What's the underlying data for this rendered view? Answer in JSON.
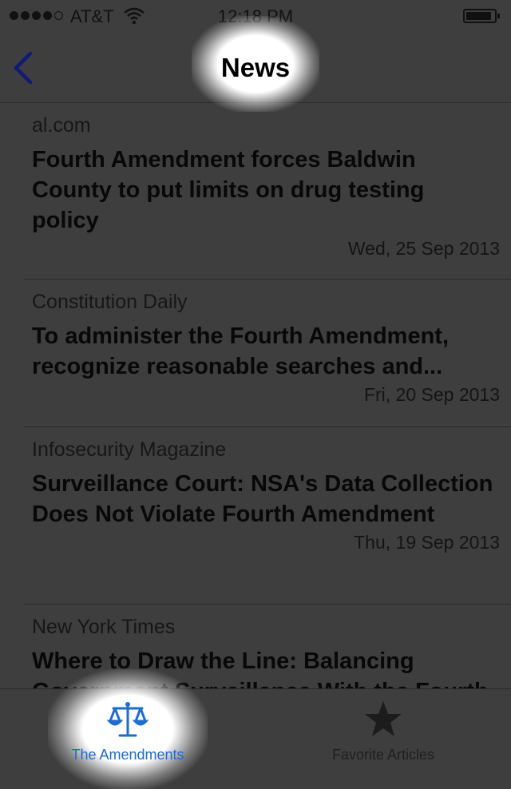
{
  "status_bar": {
    "carrier": "AT&T",
    "time": "12:18 PM"
  },
  "nav": {
    "title": "News",
    "back_icon": "chevron-left-icon"
  },
  "articles": [
    {
      "source": "al.com",
      "title": "Fourth Amendment forces Baldwin County to put limits on drug testing policy",
      "date": "Wed, 25 Sep 2013"
    },
    {
      "source": "Constitution Daily",
      "title": "To administer the Fourth Amendment, recognize reasonable searches and...",
      "date": "Fri, 20 Sep 2013"
    },
    {
      "source": "Infosecurity Magazine",
      "title": "Surveillance Court: NSA's Data Collection Does Not Violate Fourth Amendment",
      "date": "Thu, 19 Sep 2013"
    },
    {
      "source": "New York Times",
      "title": "Where to Draw the Line: Balancing Government Surveillance With the Fourth",
      "date": ""
    }
  ],
  "tabs": [
    {
      "label": "The Amendments",
      "icon": "scales-icon",
      "active": true
    },
    {
      "label": "Favorite Articles",
      "icon": "star-icon",
      "active": false
    }
  ],
  "colors": {
    "background": "#3e3e3e",
    "tab_active": "#1a6cd6",
    "back_chevron": "#101a7a"
  }
}
